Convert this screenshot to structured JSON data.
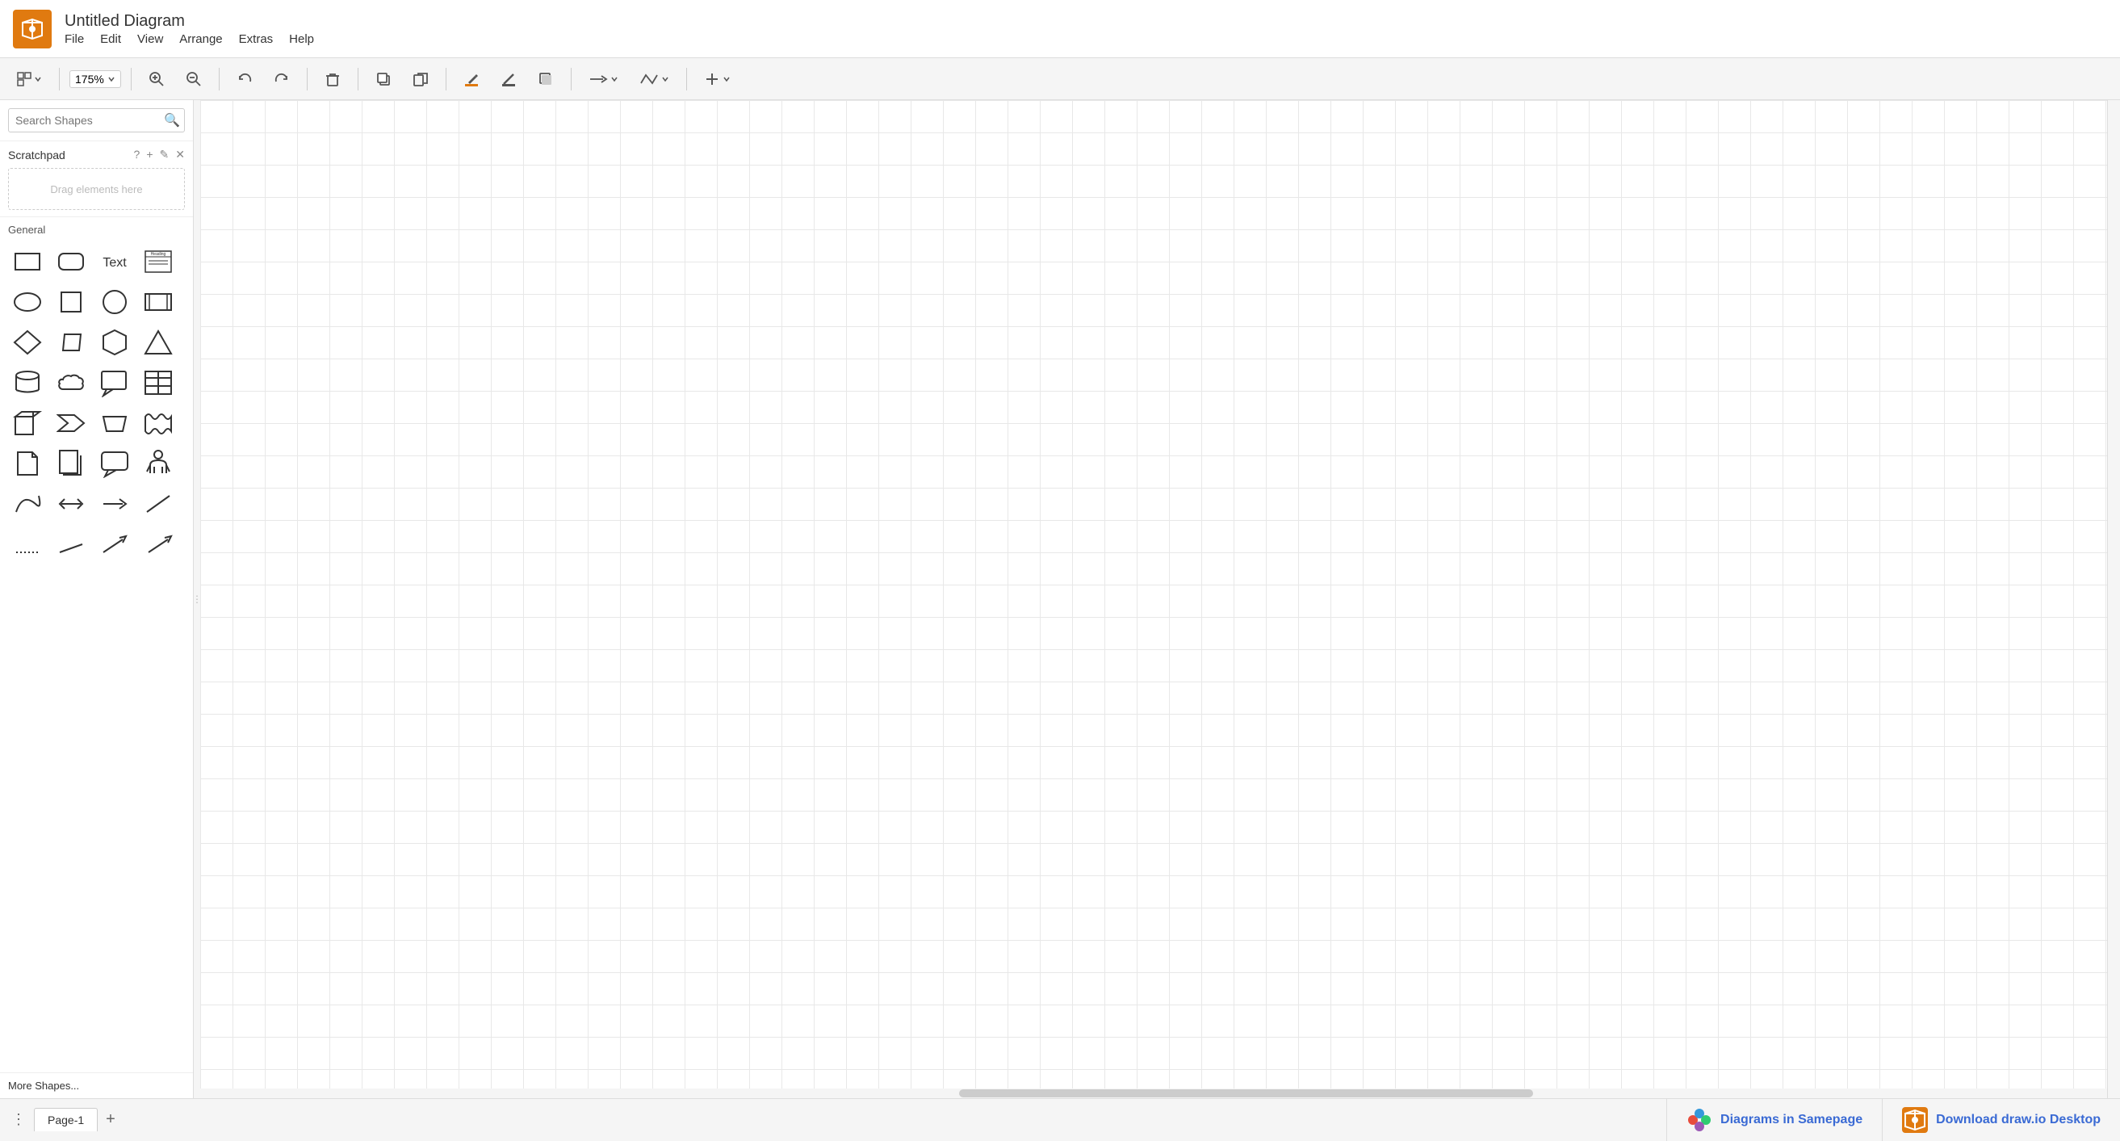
{
  "app": {
    "logo_alt": "draw.io logo"
  },
  "titlebar": {
    "title": "Untitled Diagram",
    "menu": {
      "file": "File",
      "edit": "Edit",
      "view": "View",
      "arrange": "Arrange",
      "extras": "Extras",
      "help": "Help"
    }
  },
  "toolbar": {
    "zoom_level": "175%",
    "zoom_in_label": "Zoom In",
    "zoom_out_label": "Zoom Out",
    "undo_label": "Undo",
    "redo_label": "Redo",
    "delete_label": "Delete",
    "duplicate_label": "Duplicate",
    "copy_label": "Copy",
    "fill_label": "Fill Color",
    "line_label": "Line Color",
    "shadow_label": "Shadow",
    "connection_label": "Connection",
    "waypoint_label": "Waypoints",
    "insert_label": "Insert"
  },
  "sidebar": {
    "search_placeholder": "Search Shapes",
    "scratchpad_title": "Scratchpad",
    "scratchpad_help": "?",
    "scratchpad_add": "+",
    "scratchpad_edit": "✎",
    "scratchpad_close": "✕",
    "scratchpad_drag_text": "Drag elements here",
    "general_label": "General",
    "more_shapes_label": "More Shapes..."
  },
  "shapes": [
    {
      "name": "rectangle",
      "label": "Rectangle"
    },
    {
      "name": "rounded-rect",
      "label": "Rounded Rectangle"
    },
    {
      "name": "text",
      "label": "Text"
    },
    {
      "name": "note-card",
      "label": "Note Card"
    },
    {
      "name": "ellipse",
      "label": "Ellipse"
    },
    {
      "name": "square",
      "label": "Square"
    },
    {
      "name": "circle",
      "label": "Circle"
    },
    {
      "name": "film-rect",
      "label": "Film Rectangle"
    },
    {
      "name": "diamond",
      "label": "Diamond"
    },
    {
      "name": "parallelogram",
      "label": "Parallelogram"
    },
    {
      "name": "hexagon",
      "label": "Hexagon"
    },
    {
      "name": "triangle",
      "label": "Triangle"
    },
    {
      "name": "cylinder",
      "label": "Cylinder"
    },
    {
      "name": "cloud",
      "label": "Cloud"
    },
    {
      "name": "callout",
      "label": "Callout"
    },
    {
      "name": "table",
      "label": "Table"
    },
    {
      "name": "cube",
      "label": "Cube"
    },
    {
      "name": "step",
      "label": "Step"
    },
    {
      "name": "trapezoid",
      "label": "Trapezoid"
    },
    {
      "name": "wave",
      "label": "Wave"
    },
    {
      "name": "doc",
      "label": "Document"
    },
    {
      "name": "doc-alt",
      "label": "Document Alt"
    },
    {
      "name": "speech-bubble",
      "label": "Speech Bubble"
    },
    {
      "name": "person",
      "label": "Person"
    },
    {
      "name": "curve",
      "label": "Curve"
    },
    {
      "name": "double-arrow",
      "label": "Double Arrow"
    },
    {
      "name": "arrow",
      "label": "Arrow"
    },
    {
      "name": "line",
      "label": "Line"
    },
    {
      "name": "dot-line",
      "label": "Dotted Line"
    },
    {
      "name": "line-small",
      "label": "Small Line"
    },
    {
      "name": "arrow-small",
      "label": "Small Arrow"
    },
    {
      "name": "arrow-small-2",
      "label": "Small Arrow 2"
    }
  ],
  "canvas": {
    "grid_size": 40
  },
  "bottom_bar": {
    "page_tab_label": "Page-1",
    "add_page_label": "+",
    "samepage_text": "Diagrams in Samepage",
    "drawio_text": "Download draw.io Desktop"
  }
}
